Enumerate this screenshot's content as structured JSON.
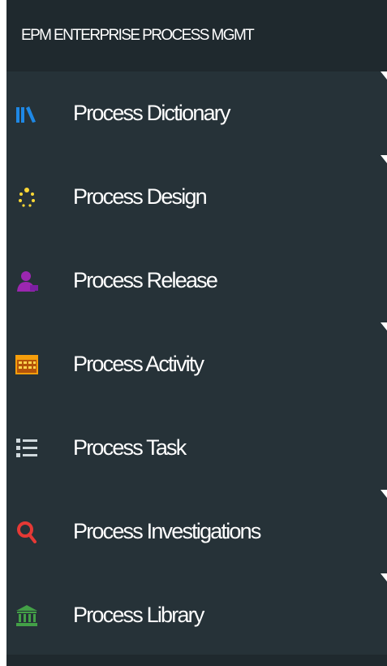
{
  "header": {
    "title": "EPM ENTERPRISE PROCESS MGMT"
  },
  "menu": {
    "items": [
      {
        "label": "Process Dictionary",
        "icon": "library-books-icon",
        "icon_color": "#1e88e5",
        "has_submenu": true
      },
      {
        "label": "Process Design",
        "icon": "design-sparkle-icon",
        "icon_color": "#fdd835",
        "has_submenu": true
      },
      {
        "label": "Process Release",
        "icon": "user-release-icon",
        "icon_color": "#9c27b0",
        "has_submenu": false
      },
      {
        "label": "Process Activity",
        "icon": "calendar-activity-icon",
        "icon_color": "#f59e0b",
        "has_submenu": true
      },
      {
        "label": "Process Task",
        "icon": "task-list-icon",
        "icon_color": "#cfd8dc",
        "has_submenu": false
      },
      {
        "label": "Process Investigations",
        "icon": "search-icon",
        "icon_color": "#e53935",
        "has_submenu": true
      },
      {
        "label": "Process Library",
        "icon": "library-building-icon",
        "icon_color": "#43a047",
        "has_submenu": true
      }
    ]
  }
}
